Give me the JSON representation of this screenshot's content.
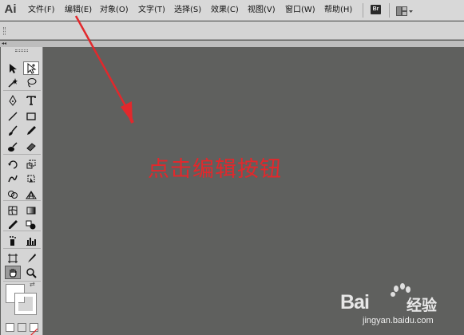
{
  "app": {
    "logo": "Ai",
    "bridge_button": "Br"
  },
  "menu": [
    "文件(F)",
    "编辑(E)",
    "对象(O)",
    "文字(T)",
    "选择(S)",
    "效果(C)",
    "视图(V)",
    "窗口(W)",
    "帮助(H)"
  ],
  "annotation": {
    "text": "点击编辑按钮",
    "color": "#e2282c"
  },
  "watermark": {
    "brand": "Bai",
    "brand_suffix": "经验",
    "url": "jingyan.baidu.com"
  },
  "tools": [
    "selection-tool",
    "direct-selection-tool",
    "magic-wand-tool",
    "lasso-tool",
    "pen-tool",
    "type-tool",
    "line-segment-tool",
    "rectangle-tool",
    "paintbrush-tool",
    "pencil-tool",
    "blob-brush-tool",
    "eraser-tool",
    "rotate-tool",
    "scale-tool",
    "warp-tool",
    "free-transform-tool",
    "shape-builder-tool",
    "perspective-grid-tool",
    "mesh-tool",
    "gradient-tool",
    "eyedropper-tool",
    "blend-tool",
    "symbol-sprayer-tool",
    "column-graph-tool",
    "artboard-tool",
    "slice-tool",
    "hand-tool",
    "zoom-tool"
  ],
  "colors": {
    "canvas": "#5f605e",
    "menubar": "#d8d8d8",
    "panel": "#d5d5d5",
    "arrow": "#e2282c"
  }
}
